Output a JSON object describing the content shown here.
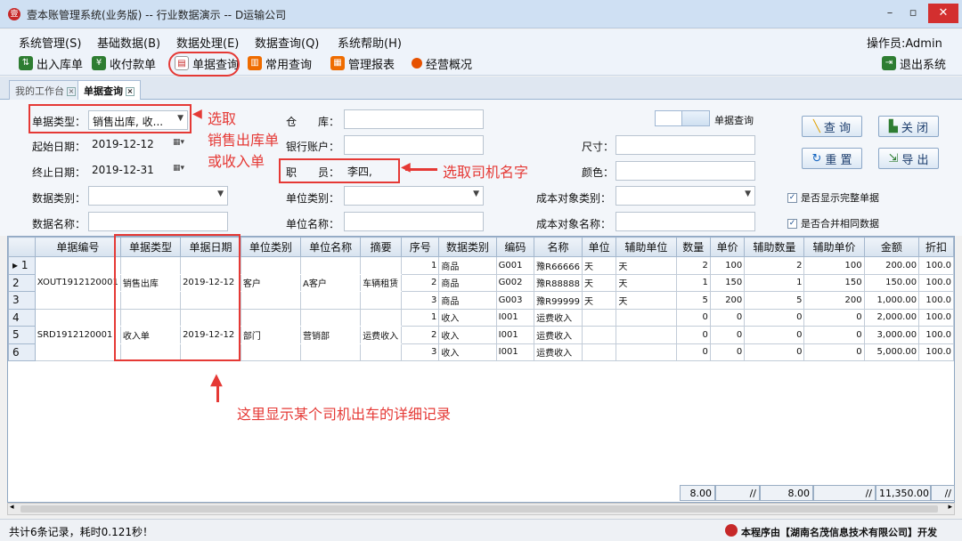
{
  "window": {
    "title": "壹本账管理系统(业务版) -- 行业数据演示 -- D运输公司",
    "logo_icon": "ledger-logo-icon"
  },
  "menu": {
    "items": [
      "系统管理(S)",
      "基础数据(B)",
      "数据处理(E)",
      "数据查询(Q)",
      "系统帮助(H)"
    ],
    "operator": "操作员:Admin"
  },
  "toolbar": {
    "items": [
      {
        "label": "出入库单",
        "icon": "inout-icon"
      },
      {
        "label": "收付款单",
        "icon": "payment-icon"
      },
      {
        "label": "单据查询",
        "icon": "doc-query-icon"
      },
      {
        "label": "常用查询",
        "icon": "chart-icon"
      },
      {
        "label": "管理报表",
        "icon": "report-icon"
      },
      {
        "label": "经营概况",
        "icon": "overview-icon"
      }
    ],
    "exit": "退出系统"
  },
  "tabs": [
    {
      "label": "我的工作台"
    },
    {
      "label": "单据查询"
    }
  ],
  "form": {
    "doc_type_label": "单据类型：",
    "doc_type_value": "销售出库, 收...",
    "start_label": "起始日期：",
    "start_value": "2019-12-12",
    "end_label": "终止日期：",
    "end_value": "2019-12-31",
    "data_type_label": "数据类别：",
    "data_name_label": "数据名称：",
    "warehouse_label": "仓　　库：",
    "bank_label": "银行账户：",
    "staff_label": "职　　员：",
    "staff_value": "李四,",
    "unit_type_label": "单位类别：",
    "unit_name_label": "单位名称：",
    "size_label": "尺寸：",
    "color_label": "颜色：",
    "cost_type_label": "成本对象类别：",
    "cost_name_label": "成本对象名称：",
    "query_toggle_label": "单据查询",
    "show_complete": "是否显示完整单据",
    "merge_same": "是否合并相同数据"
  },
  "buttons": {
    "query": "查 询",
    "close": "关 闭",
    "reset": "重 置",
    "export": "导 出"
  },
  "annotations": {
    "pick_doc_line1": "选取",
    "pick_doc_line2": "销售出库单",
    "pick_doc_line3": "或收入单",
    "pick_driver": "选取司机名字",
    "detail_note": "这里显示某个司机出车的详细记录"
  },
  "grid": {
    "headers": [
      "",
      "单据编号",
      "单据类型",
      "单据日期",
      "单位类别",
      "单位名称",
      "摘要",
      "序号",
      "数据类别",
      "编码",
      "名称",
      "单位",
      "辅助单位",
      "数量",
      "单价",
      "辅助数量",
      "辅助单价",
      "金额",
      "折扣"
    ],
    "rows": [
      [
        "▸ 1",
        "",
        "",
        "",
        "",
        "",
        "",
        "1",
        "商品",
        "G001",
        "豫R66666",
        "天",
        "天",
        "2",
        "100",
        "2",
        "100",
        "200.00",
        "100.0"
      ],
      [
        "2",
        "XOUT1912120001",
        "销售出库",
        "2019-12-12",
        "客户",
        "A客户",
        "车辆租赁",
        "2",
        "商品",
        "G002",
        "豫R88888",
        "天",
        "天",
        "1",
        "150",
        "1",
        "150",
        "150.00",
        "100.0"
      ],
      [
        "3",
        "",
        "",
        "",
        "",
        "",
        "",
        "3",
        "商品",
        "G003",
        "豫R99999",
        "天",
        "天",
        "5",
        "200",
        "5",
        "200",
        "1,000.00",
        "100.0"
      ],
      [
        "4",
        "",
        "",
        "",
        "",
        "",
        "",
        "1",
        "收入",
        "I001",
        "运费收入",
        "",
        "",
        "0",
        "0",
        "0",
        "0",
        "2,000.00",
        "100.0"
      ],
      [
        "5",
        "SRD1912120001",
        "收入单",
        "2019-12-12",
        "部门",
        "营销部",
        "运费收入",
        "2",
        "收入",
        "I001",
        "运费收入",
        "",
        "",
        "0",
        "0",
        "0",
        "0",
        "3,000.00",
        "100.0"
      ],
      [
        "6",
        "",
        "",
        "",
        "",
        "",
        "",
        "3",
        "收入",
        "I001",
        "运费收入",
        "",
        "",
        "0",
        "0",
        "0",
        "0",
        "5,000.00",
        "100.0"
      ]
    ],
    "summary": {
      "qty": "8.00",
      "aux_qty": "8.00",
      "amount": "11,350.00",
      "sep": "//"
    }
  },
  "status": {
    "text": "共计6条记录，耗时0.121秒！",
    "credit": "本程序由【湖南名茂信息技术有限公司】开发"
  }
}
